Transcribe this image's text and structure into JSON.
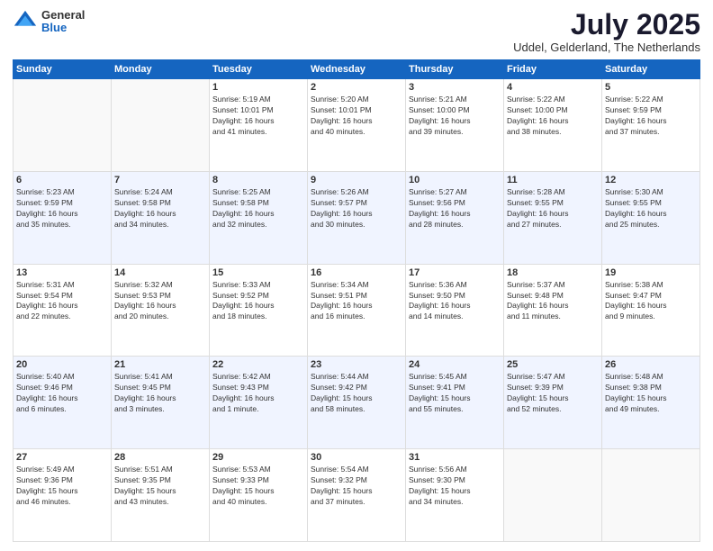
{
  "logo": {
    "general": "General",
    "blue": "Blue"
  },
  "title": "July 2025",
  "location": "Uddel, Gelderland, The Netherlands",
  "weekdays": [
    "Sunday",
    "Monday",
    "Tuesday",
    "Wednesday",
    "Thursday",
    "Friday",
    "Saturday"
  ],
  "weeks": [
    [
      {
        "day": "",
        "info": ""
      },
      {
        "day": "",
        "info": ""
      },
      {
        "day": "1",
        "info": "Sunrise: 5:19 AM\nSunset: 10:01 PM\nDaylight: 16 hours\nand 41 minutes."
      },
      {
        "day": "2",
        "info": "Sunrise: 5:20 AM\nSunset: 10:01 PM\nDaylight: 16 hours\nand 40 minutes."
      },
      {
        "day": "3",
        "info": "Sunrise: 5:21 AM\nSunset: 10:00 PM\nDaylight: 16 hours\nand 39 minutes."
      },
      {
        "day": "4",
        "info": "Sunrise: 5:22 AM\nSunset: 10:00 PM\nDaylight: 16 hours\nand 38 minutes."
      },
      {
        "day": "5",
        "info": "Sunrise: 5:22 AM\nSunset: 9:59 PM\nDaylight: 16 hours\nand 37 minutes."
      }
    ],
    [
      {
        "day": "6",
        "info": "Sunrise: 5:23 AM\nSunset: 9:59 PM\nDaylight: 16 hours\nand 35 minutes."
      },
      {
        "day": "7",
        "info": "Sunrise: 5:24 AM\nSunset: 9:58 PM\nDaylight: 16 hours\nand 34 minutes."
      },
      {
        "day": "8",
        "info": "Sunrise: 5:25 AM\nSunset: 9:58 PM\nDaylight: 16 hours\nand 32 minutes."
      },
      {
        "day": "9",
        "info": "Sunrise: 5:26 AM\nSunset: 9:57 PM\nDaylight: 16 hours\nand 30 minutes."
      },
      {
        "day": "10",
        "info": "Sunrise: 5:27 AM\nSunset: 9:56 PM\nDaylight: 16 hours\nand 28 minutes."
      },
      {
        "day": "11",
        "info": "Sunrise: 5:28 AM\nSunset: 9:55 PM\nDaylight: 16 hours\nand 27 minutes."
      },
      {
        "day": "12",
        "info": "Sunrise: 5:30 AM\nSunset: 9:55 PM\nDaylight: 16 hours\nand 25 minutes."
      }
    ],
    [
      {
        "day": "13",
        "info": "Sunrise: 5:31 AM\nSunset: 9:54 PM\nDaylight: 16 hours\nand 22 minutes."
      },
      {
        "day": "14",
        "info": "Sunrise: 5:32 AM\nSunset: 9:53 PM\nDaylight: 16 hours\nand 20 minutes."
      },
      {
        "day": "15",
        "info": "Sunrise: 5:33 AM\nSunset: 9:52 PM\nDaylight: 16 hours\nand 18 minutes."
      },
      {
        "day": "16",
        "info": "Sunrise: 5:34 AM\nSunset: 9:51 PM\nDaylight: 16 hours\nand 16 minutes."
      },
      {
        "day": "17",
        "info": "Sunrise: 5:36 AM\nSunset: 9:50 PM\nDaylight: 16 hours\nand 14 minutes."
      },
      {
        "day": "18",
        "info": "Sunrise: 5:37 AM\nSunset: 9:48 PM\nDaylight: 16 hours\nand 11 minutes."
      },
      {
        "day": "19",
        "info": "Sunrise: 5:38 AM\nSunset: 9:47 PM\nDaylight: 16 hours\nand 9 minutes."
      }
    ],
    [
      {
        "day": "20",
        "info": "Sunrise: 5:40 AM\nSunset: 9:46 PM\nDaylight: 16 hours\nand 6 minutes."
      },
      {
        "day": "21",
        "info": "Sunrise: 5:41 AM\nSunset: 9:45 PM\nDaylight: 16 hours\nand 3 minutes."
      },
      {
        "day": "22",
        "info": "Sunrise: 5:42 AM\nSunset: 9:43 PM\nDaylight: 16 hours\nand 1 minute."
      },
      {
        "day": "23",
        "info": "Sunrise: 5:44 AM\nSunset: 9:42 PM\nDaylight: 15 hours\nand 58 minutes."
      },
      {
        "day": "24",
        "info": "Sunrise: 5:45 AM\nSunset: 9:41 PM\nDaylight: 15 hours\nand 55 minutes."
      },
      {
        "day": "25",
        "info": "Sunrise: 5:47 AM\nSunset: 9:39 PM\nDaylight: 15 hours\nand 52 minutes."
      },
      {
        "day": "26",
        "info": "Sunrise: 5:48 AM\nSunset: 9:38 PM\nDaylight: 15 hours\nand 49 minutes."
      }
    ],
    [
      {
        "day": "27",
        "info": "Sunrise: 5:49 AM\nSunset: 9:36 PM\nDaylight: 15 hours\nand 46 minutes."
      },
      {
        "day": "28",
        "info": "Sunrise: 5:51 AM\nSunset: 9:35 PM\nDaylight: 15 hours\nand 43 minutes."
      },
      {
        "day": "29",
        "info": "Sunrise: 5:53 AM\nSunset: 9:33 PM\nDaylight: 15 hours\nand 40 minutes."
      },
      {
        "day": "30",
        "info": "Sunrise: 5:54 AM\nSunset: 9:32 PM\nDaylight: 15 hours\nand 37 minutes."
      },
      {
        "day": "31",
        "info": "Sunrise: 5:56 AM\nSunset: 9:30 PM\nDaylight: 15 hours\nand 34 minutes."
      },
      {
        "day": "",
        "info": ""
      },
      {
        "day": "",
        "info": ""
      }
    ]
  ]
}
